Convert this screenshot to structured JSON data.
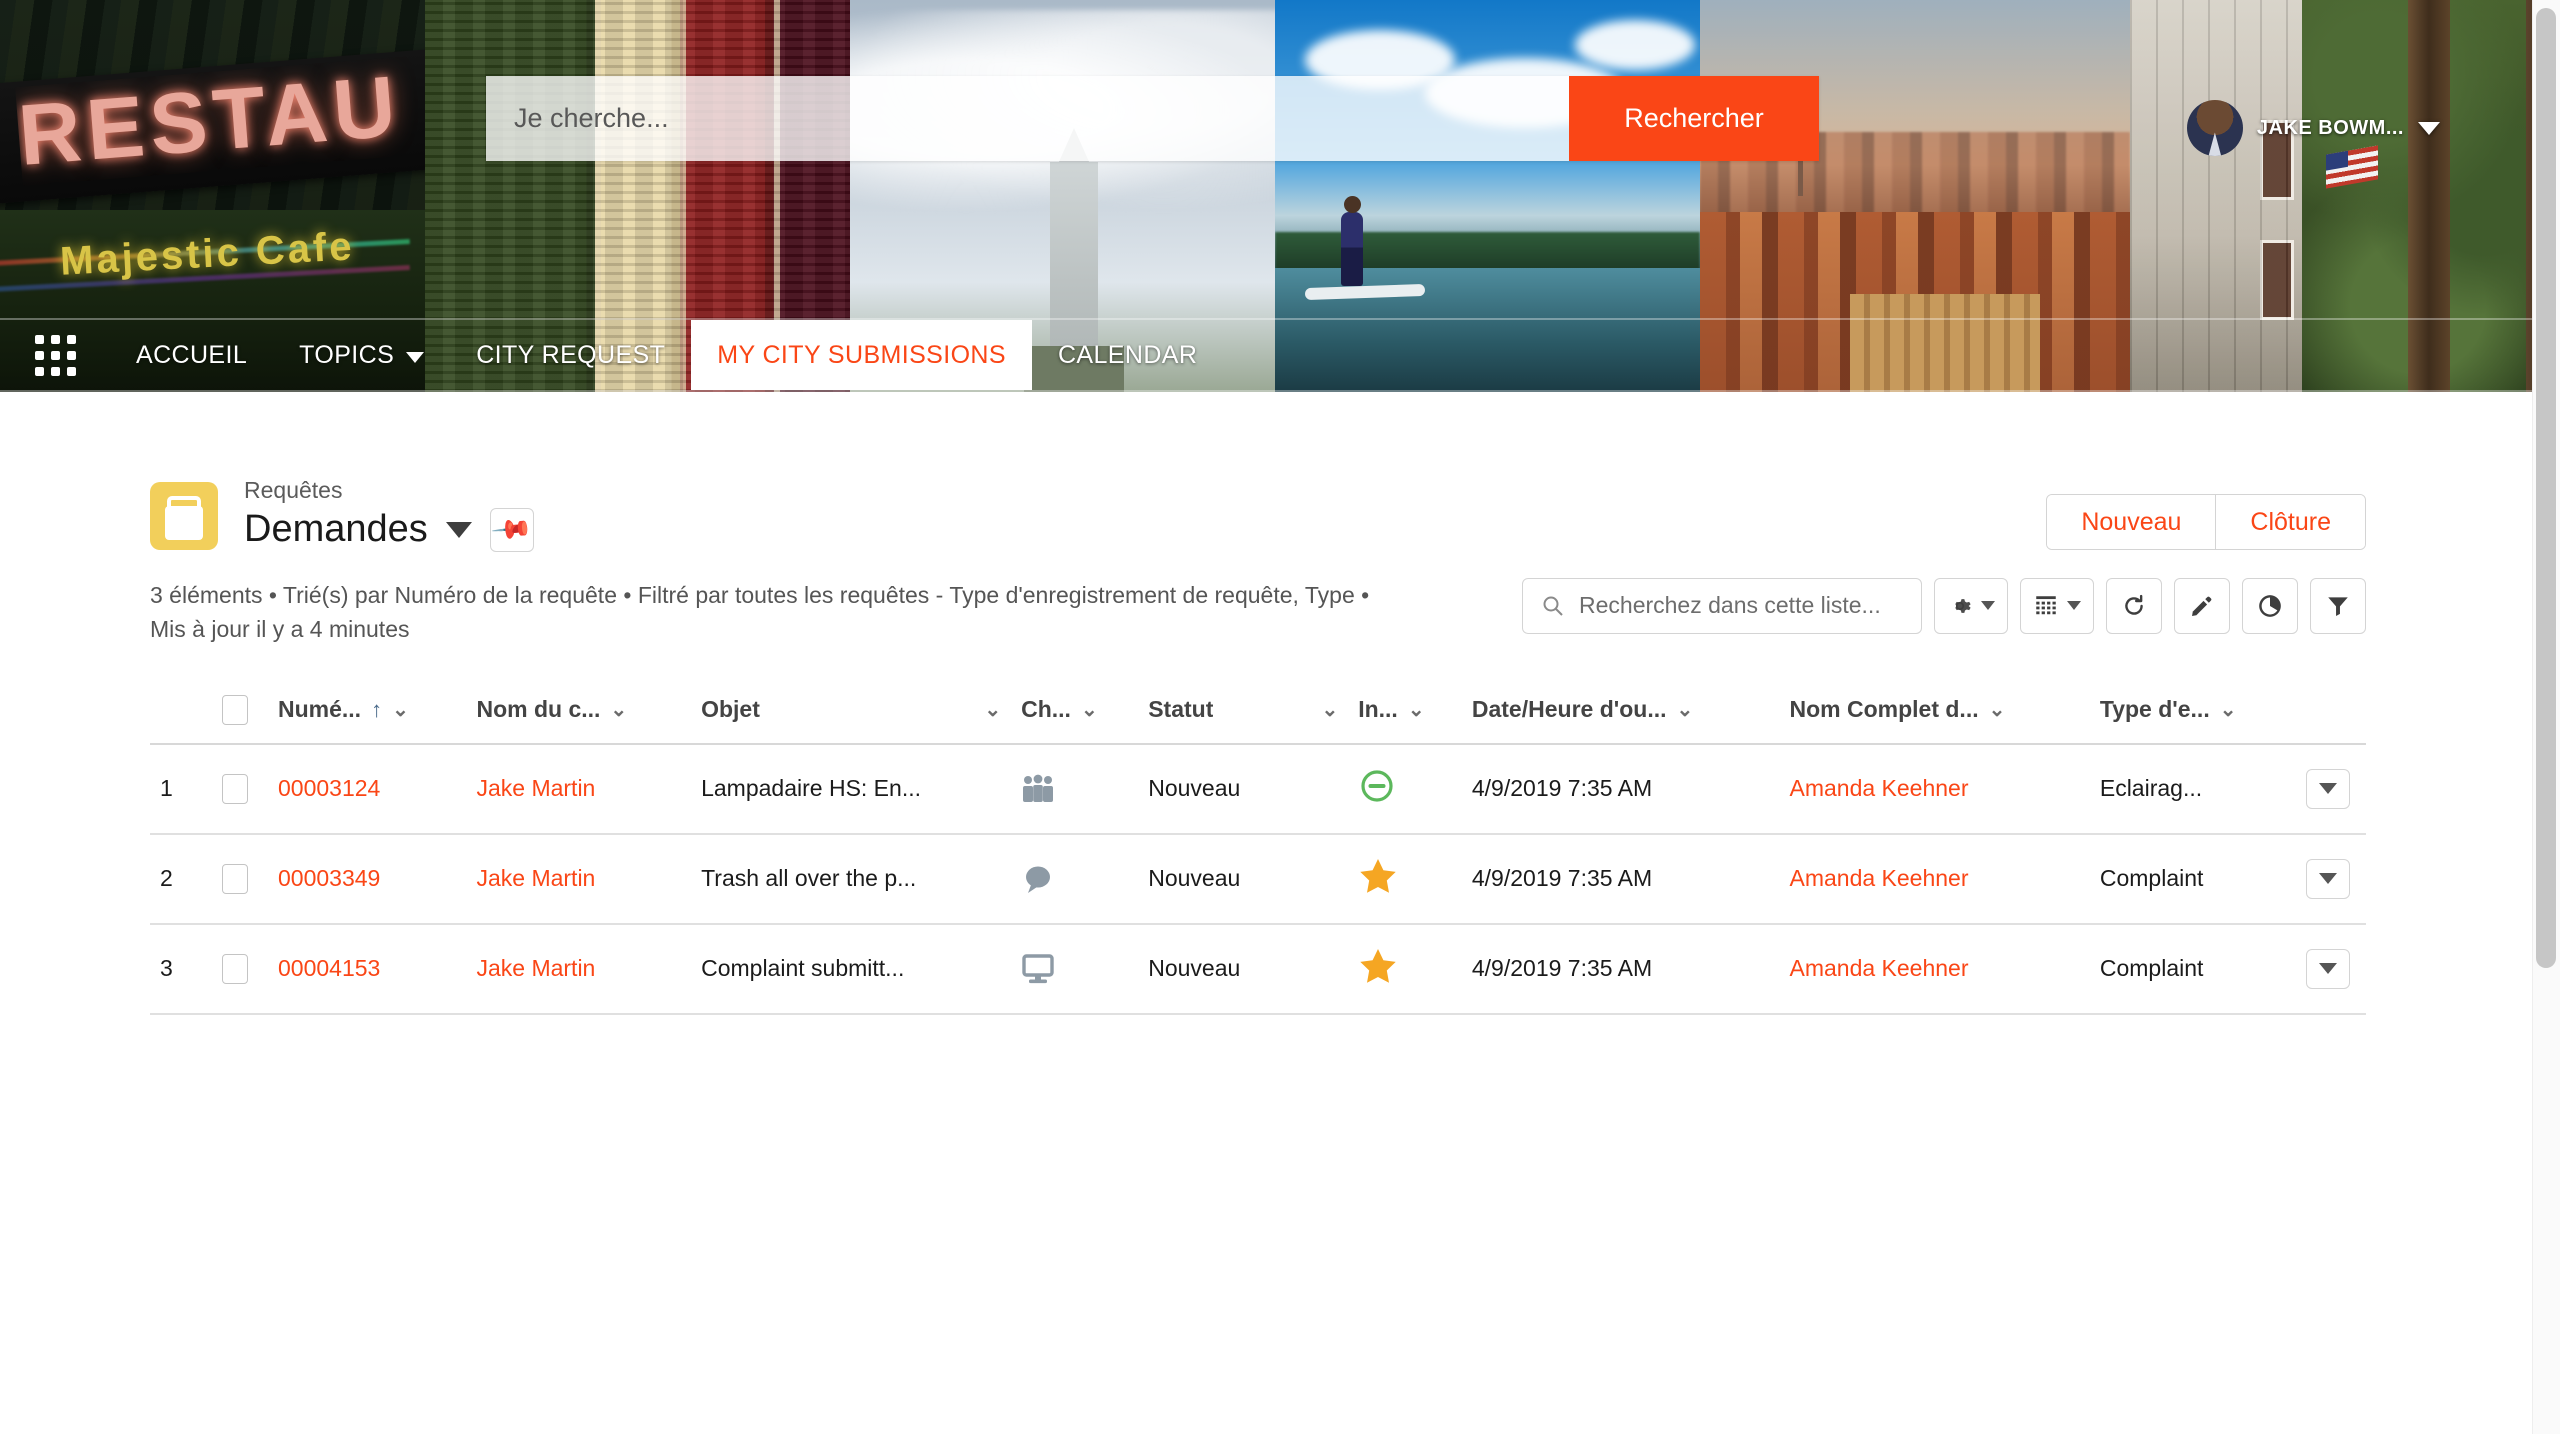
{
  "hero": {
    "panels": [
      "restaurant-neon-photo",
      "produce-crates-photo",
      "monument-sky-photo",
      "paddleboard-water-photo",
      "dusk-cityscape-photo",
      "rowhouse-street-photo"
    ],
    "neon_sign_text": "RESTAU",
    "cafe_sign_text": "Majestic Cafe"
  },
  "search": {
    "placeholder": "Je cherche...",
    "button_label": "Rechercher",
    "button_color": "#FA4616"
  },
  "user": {
    "name": "JAKE BOWM...",
    "avatar_icon": "user-avatar"
  },
  "nav": {
    "waffle_icon": "app-launcher-icon",
    "items": [
      {
        "label": "ACCUEIL",
        "active": false,
        "has_caret": false
      },
      {
        "label": "TOPICS",
        "active": false,
        "has_caret": true
      },
      {
        "label": "CITY REQUEST",
        "active": false,
        "has_caret": false
      },
      {
        "label": "MY CITY SUBMISSIONS",
        "active": true,
        "has_caret": false
      },
      {
        "label": "CALENDAR",
        "active": false,
        "has_caret": false
      }
    ]
  },
  "listview": {
    "object_icon": "case-briefcase-icon",
    "eyebrow": "Requêtes",
    "title": "Demandes",
    "pin_icon": "pin-icon",
    "actions": [
      {
        "label": "Nouveau"
      },
      {
        "label": "Clôture"
      }
    ],
    "meta": "3 éléments • Trié(s) par Numéro de la requête • Filtré par toutes les requêtes - Type d'enregistrement de requête, Type • Mis à jour il y a 4 minutes",
    "search_placeholder": "Recherchez dans cette liste...",
    "search_icon": "search-icon",
    "tools": [
      {
        "icon": "gear-icon",
        "has_caret": true
      },
      {
        "icon": "list-view-grid-icon",
        "has_caret": true
      },
      {
        "icon": "refresh-icon",
        "has_caret": false
      },
      {
        "icon": "pencil-edit-icon",
        "has_caret": false
      },
      {
        "icon": "chart-pie-icon",
        "has_caret": false
      },
      {
        "icon": "filter-funnel-icon",
        "has_caret": false
      }
    ]
  },
  "table": {
    "columns": [
      {
        "label": "Numé...",
        "sorted": true,
        "sort_dir": "asc"
      },
      {
        "label": "Nom du c...",
        "sorted": false
      },
      {
        "label": "Objet",
        "sorted": false
      },
      {
        "label": "Ch...",
        "sorted": false
      },
      {
        "label": "Statut",
        "sorted": false
      },
      {
        "label": "In...",
        "sorted": false
      },
      {
        "label": "Date/Heure d'ou...",
        "sorted": false
      },
      {
        "label": "Nom Complet d...",
        "sorted": false
      },
      {
        "label": "Type d'e...",
        "sorted": false
      }
    ],
    "rows": [
      {
        "num": "1",
        "case_number": "00003124",
        "contact": "Jake Martin",
        "subject": "Lampadaire HS: En...",
        "channel_icon": "people-group-icon",
        "status": "Nouveau",
        "priority_icon": "circle-minus-green-icon",
        "opened": "4/9/2019 7:35 AM",
        "owner": "Amanda Keehner",
        "type": "Eclairag..."
      },
      {
        "num": "2",
        "case_number": "00003349",
        "contact": "Jake Martin",
        "subject": "Trash all over the p...",
        "channel_icon": "chat-bubble-icon",
        "status": "Nouveau",
        "priority_icon": "star-orange-icon",
        "opened": "4/9/2019 7:35 AM",
        "owner": "Amanda Keehner",
        "type": "Complaint"
      },
      {
        "num": "3",
        "case_number": "00004153",
        "contact": "Jake Martin",
        "subject": "Complaint submitt...",
        "channel_icon": "monitor-web-icon",
        "status": "Nouveau",
        "priority_icon": "star-orange-icon",
        "opened": "4/9/2019 7:35 AM",
        "owner": "Amanda Keehner",
        "type": "Complaint"
      }
    ]
  },
  "colors": {
    "brand_orange": "#FA4616",
    "icon_yellow": "#F2CF5B",
    "star_orange": "#F5A623",
    "green": "#4BB543"
  }
}
